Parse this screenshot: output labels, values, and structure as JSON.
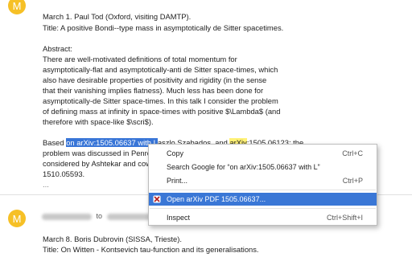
{
  "message1": {
    "avatar_letter": "M",
    "lines": {
      "l1": "March 1. Paul Tod (Oxford, visiting DAMTP).",
      "l2": "Title: A positive Bondi--type mass in asymptotically de Sitter spacetimes.",
      "l3": "Abstract:",
      "l4": "There are well-motivated definitions of total momentum for",
      "l5": "asymptotically-flat and asymptotically-anti de Sitter space-times, which",
      "l6": "also have desirable properties of positivity and rigidity (in the sense",
      "l7": "that their vanishing implies flatness). Much less has been done for",
      "l8": "asymptotically-de Sitter space-times. In this talk I consider the problem",
      "l9": "of defining mass at infinity in space-times with positive $\\Lambda$ (and",
      "l10": "therefore with space-like $\\scri$).",
      "l11_a": "Based ",
      "l11_sel": "on arXiv:1505.06637 with L",
      "l11_b": "aszlo Szabados, and ",
      "l11_hl": "arXiv",
      "l11_c": ":1505.06123; the",
      "l12_a": "problem was discussed in ",
      "l12_b": "Penro",
      "l13": "considered by Ashtekar and cowo",
      "l14": "1510.05593.",
      "ellipsis": "..."
    }
  },
  "message2": {
    "avatar_letter": "M",
    "to_label": "to",
    "lines": {
      "l1": "March 8. Boris Dubrovin (SISSA, Trieste).",
      "l2": "Title: On Witten - Kontsevich tau-function and its generalisations."
    }
  },
  "context_menu": {
    "items": [
      {
        "label": "Copy",
        "shortcut": "Ctrl+C"
      },
      {
        "label": "Search Google for “on arXiv:1505.06637 with L”",
        "shortcut": ""
      },
      {
        "label": "Print...",
        "shortcut": "Ctrl+P"
      },
      {
        "label": "Open arXiv PDF 1505.06637...",
        "shortcut": "",
        "icon": "arxiv-extension-icon"
      },
      {
        "label": "Inspect",
        "shortcut": "Ctrl+Shift+I"
      }
    ]
  },
  "colors": {
    "avatar": "#f6c026",
    "selection": "#3875d7",
    "menu_highlight": "#3a77d6",
    "search_highlight": "#fff176"
  }
}
